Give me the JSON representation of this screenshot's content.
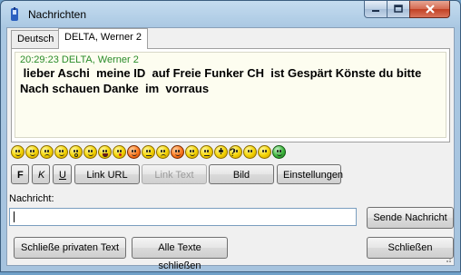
{
  "window": {
    "title": "Nachrichten"
  },
  "tabs": [
    {
      "label": "Deutsch",
      "active": false
    },
    {
      "label": "DELTA, Werner 2",
      "active": true
    }
  ],
  "chat": {
    "meta": "20:29:23 DELTA, Werner 2",
    "text": " lieber Aschi  meine ID  auf Freie Funker CH  ist Gespärt Könste du bitte Nach schauen Danke  im  vorraus"
  },
  "smileys": [
    "smile",
    "grin",
    "sad",
    "wink",
    "surprised",
    "cool",
    "laugh",
    "kiss",
    "tongue",
    "confused",
    "angry",
    "devil",
    "embarrassed",
    "sleepy",
    "exclamation",
    "question",
    "idea",
    "arrow",
    "alien"
  ],
  "format_toolbar": {
    "bold": "F",
    "italic": "K",
    "underline": "U",
    "link_url": "Link URL",
    "link_text": "Link Text",
    "bild": "Bild",
    "einstellungen": "Einstellungen"
  },
  "message": {
    "label": "Nachricht:",
    "value": "",
    "send": "Sende Nachricht"
  },
  "footer": {
    "close_private": "Schließe privaten Text",
    "close_all": "Alle Texte schließen",
    "close": "Schließen"
  }
}
